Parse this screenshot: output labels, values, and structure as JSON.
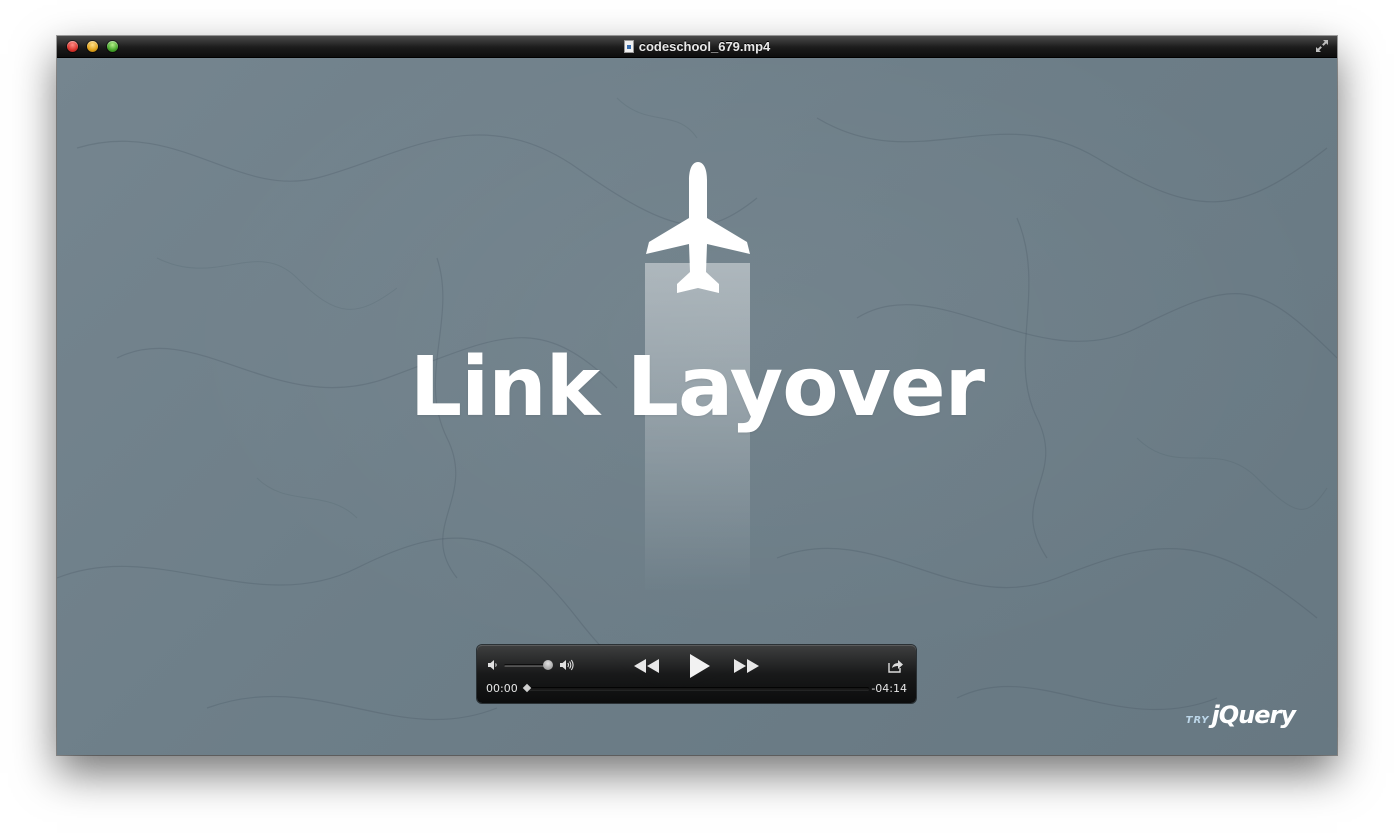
{
  "window": {
    "title": "codeschool_679.mp4"
  },
  "video": {
    "title": "Link Layover",
    "brand_prefix": "TRY",
    "brand_name": "jQuery"
  },
  "controls": {
    "current_time": "00:00",
    "remaining_time": "-04:14",
    "volume_level": 0.95,
    "playback_progress": 0.0
  },
  "icons": {
    "close": "close-button",
    "minimize": "minimize-button",
    "zoom": "zoom-button",
    "fullscreen": "fullscreen-arrows-icon",
    "file": "movie-file-icon",
    "volume_low": "speaker-low-icon",
    "volume_high": "speaker-high-icon",
    "rewind": "rewind-icon",
    "play": "play-icon",
    "fast_forward": "fast-forward-icon",
    "share": "share-icon",
    "plane": "airplane-icon"
  },
  "colors": {
    "video_background": "#6d7e88",
    "title_text": "#ffffff",
    "controller_background": "#141414"
  }
}
